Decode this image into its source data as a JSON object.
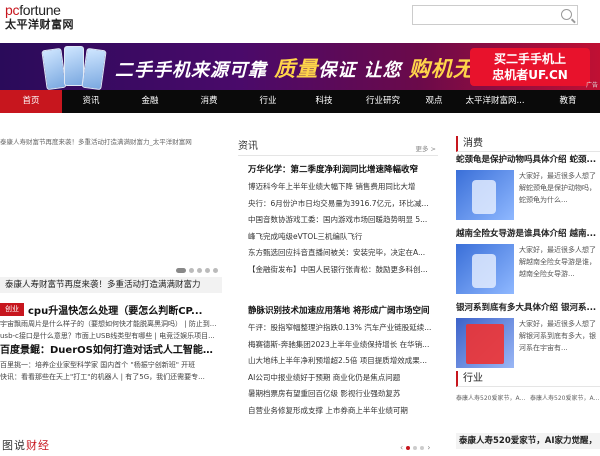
{
  "header": {
    "logo_pc": "pc",
    "logo_fortune": "fortune",
    "logo_cn": "太平洋财富网",
    "search_placeholder": ""
  },
  "banner": {
    "slogan_a": "二手手机来源可靠",
    "slogan_b": "质量",
    "slogan_c": "保证 让您",
    "slogan_d": "购机无忧",
    "cta_line1": "买二手手机上",
    "cta_line2": "忠机者UF.CN",
    "ad": "广告"
  },
  "nav": {
    "items": [
      "首页",
      "资讯",
      "金融",
      "消费",
      "行业",
      "科技",
      "行业研究",
      "观点",
      "太平洋财富网...",
      "教育"
    ]
  },
  "hero": {
    "breadcrumb": "泰康人寿财富节再度来袭！多重活动打造满满财富力_太平洋财富网",
    "caption": "泰康人寿财富节再度来袭！多重活动打造满满财富力"
  },
  "leftlist": {
    "tag": "创业",
    "headline1": "cpu升温快怎么处理（要怎么判断CP...",
    "sub1_a": "宇宙飘雨周片是什么样子的（要想如何快才能脱离黑洞吗）",
    "sub1_b": "防止到...",
    "sub2_a": "usb-c接口是什么意思？市面上USB线类型有哪些",
    "sub2_b": "电竞泛娱乐项目...",
    "headline2": "百度景鲲：DuerOS如何打造对话式人工智能生...",
    "sub3_a": "百里挑一：培养企业家型科学家 国内首个",
    "sub3_b": "\"杨振宁创新班\" 开班",
    "sub4_a": "快讯：看看那些在天上\"打工\"的机器人",
    "sub4_b": "有了5G，我们还需要专..."
  },
  "tushuo": {
    "a": "图说",
    "b": "财经"
  },
  "middle": {
    "section_title": "资讯",
    "more": "更多 >",
    "headline1": "万华化学：第二季度净利润同比增速降幅收窄",
    "list1": [
      "博迈科今年上半年业绩大幅下降 销售费用同比大增",
      "央行：6月份沪市日均交易量为3916.7亿元，环比减...",
      "中国音数协游戏工委：国内游戏市场回暖趋势明显 5...",
      "峰飞完成吨级eVTOL三机编队飞行",
      "东方甄选回应抖音直播间被关：安装完毕，决定在A...",
      "【金融街发布】中国人民银行张青松：鼓励更多科创..."
    ],
    "headline2": "静脉识别技术加速应用落地 将形成广阔市场空间",
    "list2": [
      "午评：股指窄幅整理沪指跌0.13% 汽车产业链股延续...",
      "梅赛德斯-奔驰集团2023上半年业绩保持增长 在华销...",
      "山大地纬上半年净利预增超2.5倍 项目提质增效成果...",
      "AI公司中报业绩好于预期 商业化仍是焦点问题",
      "暑期档票房有望重回百亿级 影视行业强劲复苏",
      "自营业务修复形成支撑 上市券商上半年业绩可期"
    ]
  },
  "right": {
    "xiaofei_title": "消费",
    "card1_title": "蛇颈龟是保护动物吗具体介绍 蛇颈...",
    "card1_desc": "大家好，最近很多人想了解蛇颈龟是保护动物吗，蛇颈龟为什么...",
    "card2_title": "越南全险女导游是谁具体介绍 越南...",
    "card2_desc": "大家好，最近很多人想了解越南全险女导游是谁，越南全险女导游...",
    "card3_title": "银河系到底有多大具体介绍 银河系...",
    "card3_desc": "大家好，最近很多人想了解银河系到底有多大，银河系在宇宙有...",
    "hangye_title": "行业",
    "hangye_img1": "泰康人寿520爱家节，AI家力觉醒...",
    "hangye_img2": "泰康人寿520爱家节，AI家力觉醒...",
    "hangye_lead": "泰康人寿520爱家节，AI家力觉醒，"
  },
  "colors": {
    "accent": "#c7161e",
    "nav_bg": "#0a0a0a",
    "banner_yellow": "#ffd54a"
  }
}
